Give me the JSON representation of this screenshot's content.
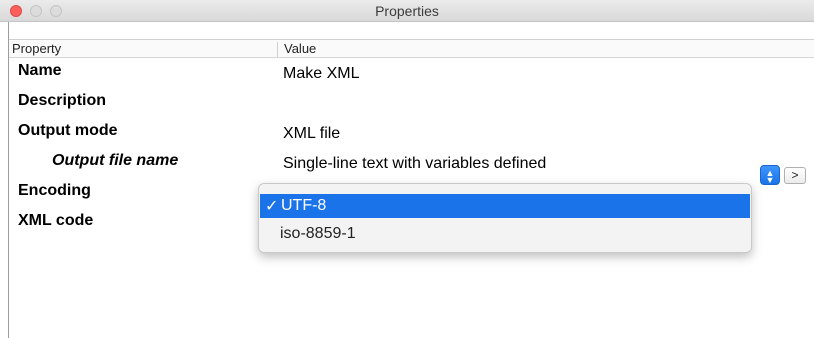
{
  "window": {
    "title": "Properties",
    "buttons": {
      "close": "close",
      "minimize": "minimize",
      "zoom": "zoom"
    }
  },
  "table": {
    "columns": {
      "property": "Property",
      "value": "Value"
    },
    "rows": [
      {
        "label": "Name",
        "value": "Make XML"
      },
      {
        "label": "Description",
        "value": ""
      },
      {
        "label": "Output mode",
        "value": "XML file"
      },
      {
        "label": "Output file name",
        "value": "Single-line text with variables defined"
      },
      {
        "label": "Encoding",
        "value": ""
      },
      {
        "label": "XML code",
        "value": ""
      }
    ]
  },
  "encoding_dropdown": {
    "selected_check": "✓",
    "options": [
      "UTF-8",
      "iso-8859-1"
    ],
    "more_button": ">"
  },
  "colors": {
    "selection": "#1a73e8",
    "close_button": "#fc605c"
  }
}
